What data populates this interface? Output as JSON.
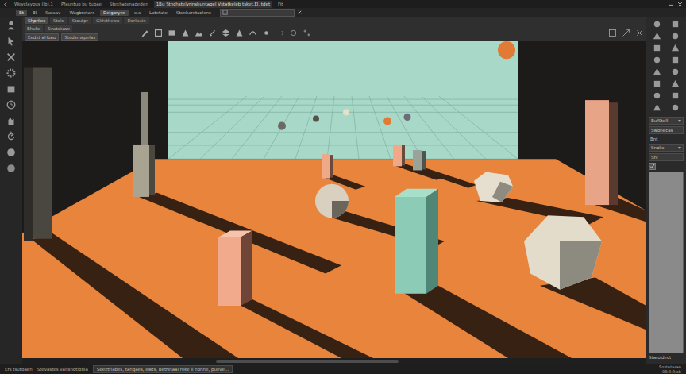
{
  "window": {
    "tabs": [
      {
        "label": "Weyclayous (lb).1",
        "selected": false
      },
      {
        "label": "Pfauntuo bu tubae",
        "selected": false
      },
      {
        "label": "Stexhatenadeden",
        "selected": false
      },
      {
        "label": "1Bu Stnchstelyrinshuntaqel Vstatkeleb tsket.El, tdet",
        "selected": true
      },
      {
        "label": "Fit",
        "selected": false
      }
    ]
  },
  "menu": [
    {
      "label": "Bt",
      "selected": true
    },
    {
      "label": "Bl",
      "selected": false
    },
    {
      "label": "Saraav",
      "selected": false
    },
    {
      "label": "Wagbretars",
      "selected": false
    },
    {
      "label": "Delgoryex",
      "selected": true
    },
    {
      "label": "e.s",
      "selected": false
    },
    {
      "label": "Latefate",
      "selected": false
    },
    {
      "label": "Stexkaretaclenc",
      "selected": false
    }
  ],
  "doc_tabs": [
    {
      "label": "Shpriles",
      "selected": true
    },
    {
      "label": "Stolc",
      "selected": false
    },
    {
      "label": "Stoutpr",
      "selected": false
    },
    {
      "label": "Gkhithewo",
      "selected": false
    },
    {
      "label": "Dorlauin",
      "selected": false
    }
  ],
  "options": [
    "Bhuke",
    "Svatsluwe"
  ],
  "options2": [
    "Eedxt aHbao",
    "Stedsmapelas"
  ],
  "right_panel": {
    "fields": [
      {
        "label": "Bu/Stell",
        "kind": "dropdown"
      },
      {
        "label": "Swonecas",
        "kind": "field"
      },
      {
        "label": "Bnt",
        "kind": "label"
      },
      {
        "label": "Snoks",
        "kind": "dropdown"
      },
      {
        "label": "Shl",
        "kind": "field"
      }
    ],
    "checked": true,
    "footer": "Staroldect"
  },
  "status_bar": {
    "left": [
      "Ers tsutoaen",
      "Stevastes vaitshotionia"
    ],
    "message": "Seextriabes, tanqaes, ewts, Betretaal reke li nonne, pueve...",
    "right": [
      "Soxtetasan",
      "08:0:0:ob"
    ]
  }
}
